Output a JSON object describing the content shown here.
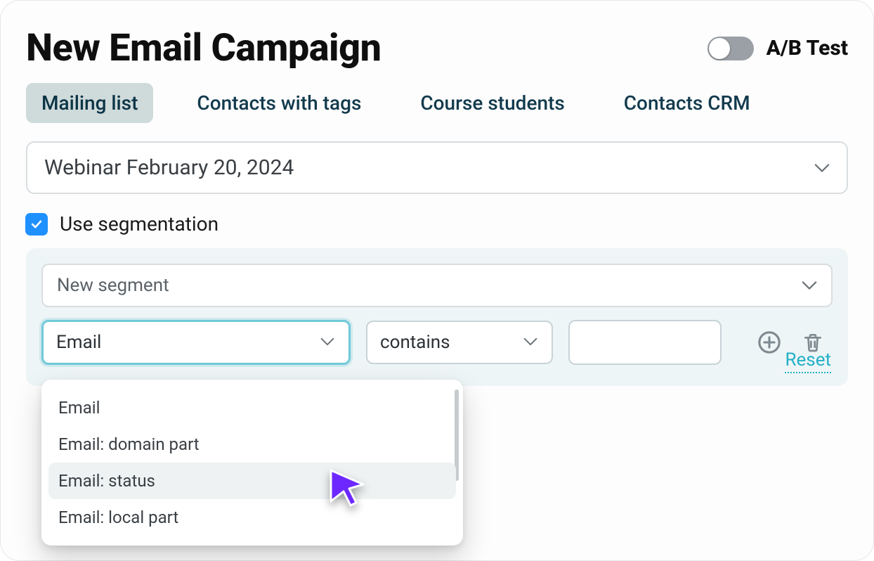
{
  "header": {
    "title": "New Email Campaign",
    "ab_label": "A/B Test",
    "ab_enabled": false
  },
  "tabs": [
    {
      "id": "mailing-list",
      "label": "Mailing list",
      "active": true
    },
    {
      "id": "contacts-tags",
      "label": "Contacts with tags",
      "active": false
    },
    {
      "id": "course-students",
      "label": "Course students",
      "active": false
    },
    {
      "id": "contacts-crm",
      "label": "Contacts CRM",
      "active": false
    }
  ],
  "list_select": {
    "value": "Webinar February 20, 2024"
  },
  "segmentation": {
    "checkbox_checked": true,
    "label": "Use segmentation"
  },
  "segment_select": {
    "value": "New segment"
  },
  "rule": {
    "field": "Email",
    "operator": "contains",
    "value": ""
  },
  "field_dropdown": {
    "open": true,
    "hover_index": 2,
    "options": [
      "Email",
      "Email: domain part",
      "Email: status",
      "Email: local part"
    ]
  },
  "reset_label": "Reset",
  "colors": {
    "tab_active_bg": "#cfdada",
    "tab_text": "#123a4d",
    "focus_ring": "#6fc9d8",
    "checkbox": "#1e90ff",
    "panel_bg": "#eef5f6",
    "reset": "#21b0c7",
    "cursor": "#6d28ff"
  }
}
